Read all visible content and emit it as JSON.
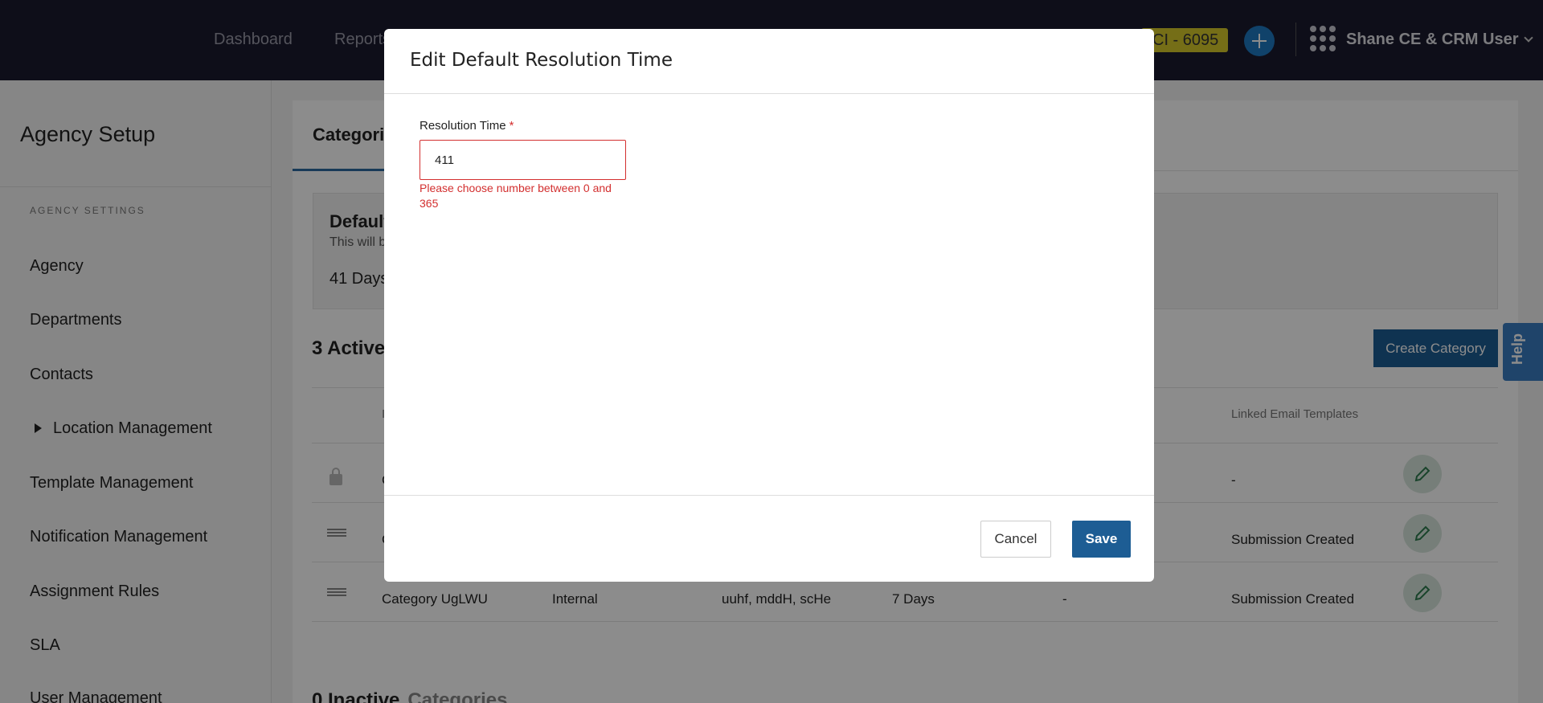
{
  "topnav": {
    "links": [
      "Dashboard",
      "Reports"
    ],
    "ticket_badge": "CI - 6095",
    "user_name": "Shane CE & CRM User"
  },
  "sidebar": {
    "title": "Agency Setup",
    "section_label": "AGENCY SETTINGS",
    "items": [
      {
        "label": "Agency"
      },
      {
        "label": "Departments"
      },
      {
        "label": "Contacts"
      },
      {
        "label": "Location Management"
      },
      {
        "label": "Template Management"
      },
      {
        "label": "Notification Management"
      },
      {
        "label": "Assignment Rules"
      },
      {
        "label": "SLA"
      },
      {
        "label": "User Management"
      }
    ]
  },
  "main": {
    "tab_label": "Categori",
    "default_title": "Default",
    "default_desc": "This will b",
    "default_value": "41 Days",
    "active_title": "3 Active",
    "create_button": "Create Category",
    "headers": {
      "col_i": "I",
      "linked": "Linked Email Templates"
    },
    "rows": [
      {
        "name": "C",
        "type": "",
        "tags": "",
        "time": "",
        "dash": "",
        "linked": "-"
      },
      {
        "name": "C",
        "type": "",
        "tags": "",
        "time": "",
        "dash": "",
        "linked": "Submission Created"
      },
      {
        "name": "Category UgLWU",
        "type": "Internal",
        "tags": "uuhf, mddH, scHe",
        "time": "7 Days",
        "dash": "-",
        "linked": "Submission Created"
      }
    ],
    "inactive_count": "0 Inactive",
    "inactive_word": "Categories"
  },
  "help_label": "Help",
  "modal": {
    "title": "Edit Default Resolution Time",
    "field_label": "Resolution Time",
    "required_mark": "*",
    "field_value": "411",
    "error": "Please choose number between 0 and 365",
    "cancel": "Cancel",
    "save": "Save"
  },
  "colors": {
    "primary": "#1d5d94",
    "error": "#d32f2f",
    "nav_bg": "#1b1b2e",
    "badge": "#d6c92a"
  }
}
